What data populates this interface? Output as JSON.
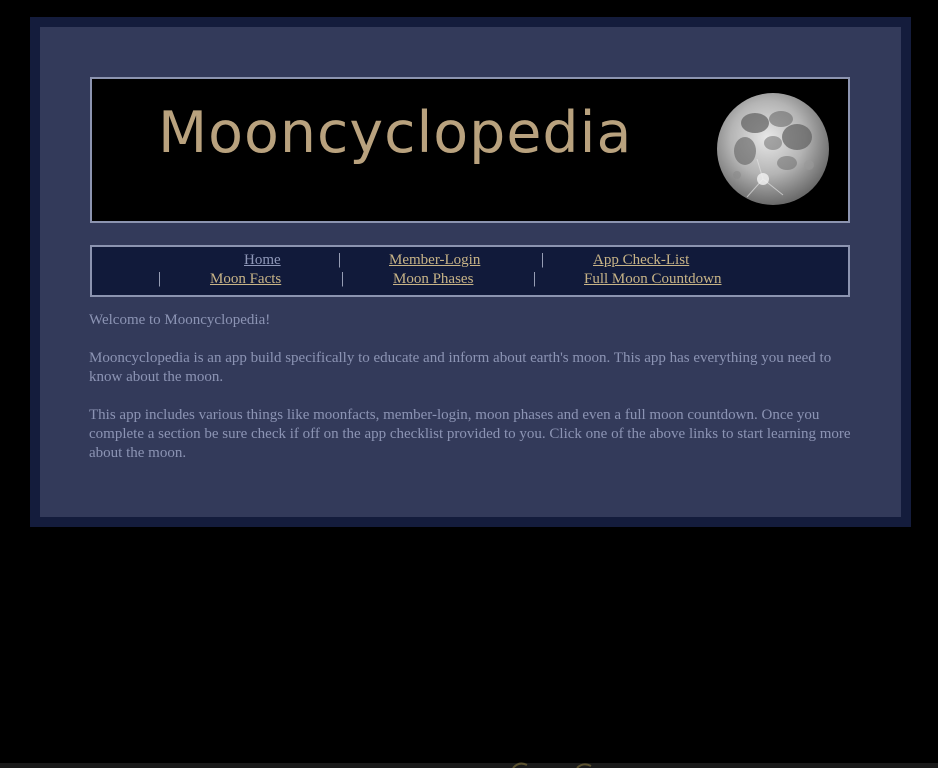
{
  "banner": {
    "title": "Mooncyclopedia",
    "moon_icon": "full-moon-image"
  },
  "nav": {
    "separator": "|",
    "links": [
      {
        "label": "Home",
        "state": "current"
      },
      {
        "label": "Member-Login"
      },
      {
        "label": "App Check-List"
      },
      {
        "label": "Moon Facts"
      },
      {
        "label": "Moon Phases"
      },
      {
        "label": "Full Moon Countdown"
      }
    ]
  },
  "content": {
    "welcome": "Welcome to Mooncyclopedia!",
    "paragraph1": "Mooncyclopedia is an app build specifically to educate and inform about earth's moon. This app has everything you need to know about the moon.",
    "paragraph2": "This app includes various things like moonfacts, member-login, moon phases and even a full moon countdown. Once you complete a section be sure check if off on the app checklist provided to you. Click one of the above links to start learning more about the moon."
  },
  "colors": {
    "page_bg": "#000000",
    "frame": "#141c3c",
    "panel": "#333a5a",
    "nav_bg": "#111a3a",
    "title_gold": "#b9a27e",
    "link_gold": "#c8b487",
    "text_muted": "#8c94b4"
  }
}
